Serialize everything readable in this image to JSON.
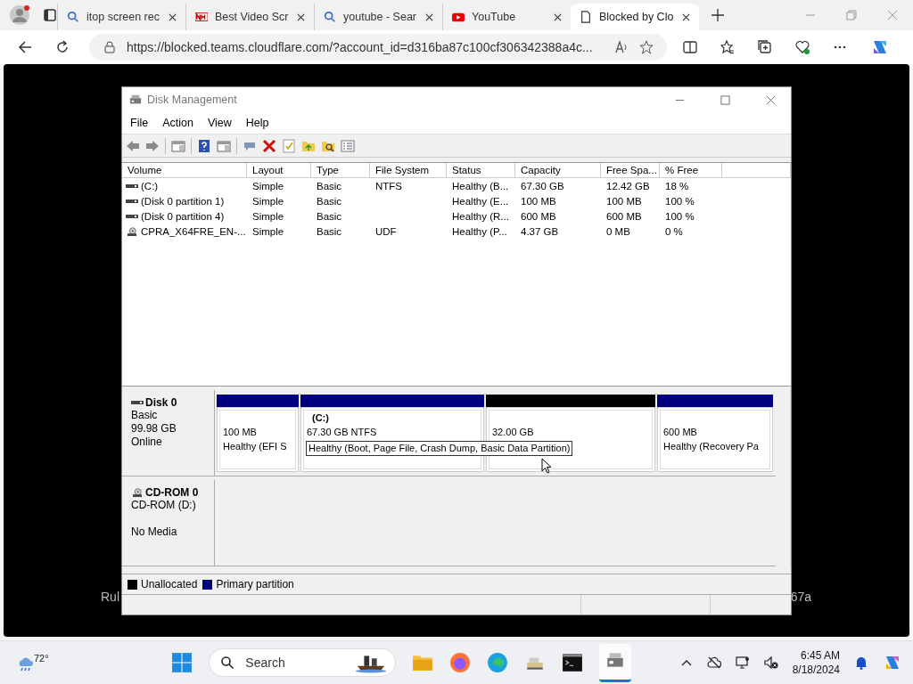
{
  "browser": {
    "tabs": [
      {
        "title": "itop screen rec",
        "kind": "search",
        "selected": false
      },
      {
        "title": "Best Video Scr",
        "kind": "nch",
        "selected": false
      },
      {
        "title": "youtube - Sear",
        "kind": "search",
        "selected": false
      },
      {
        "title": "YouTube",
        "kind": "youtube",
        "selected": false
      },
      {
        "title": "Blocked by Clo",
        "kind": "page",
        "selected": true
      }
    ],
    "url": "https://blocked.teams.cloudflare.com/?account_id=d316ba87c100cf306342388a4c...",
    "behind_left": "Rul",
    "behind_right": "67a"
  },
  "window": {
    "title": "Disk Management",
    "menu": [
      "File",
      "Action",
      "View",
      "Help"
    ],
    "columns": [
      "Volume",
      "Layout",
      "Type",
      "File System",
      "Status",
      "Capacity",
      "Free Spa...",
      "% Free"
    ],
    "rows": [
      {
        "kind": "disk",
        "cells": [
          "(C:)",
          "Simple",
          "Basic",
          "NTFS",
          "Healthy (B...",
          "67.30 GB",
          "12.42 GB",
          "18 %"
        ]
      },
      {
        "kind": "disk",
        "cells": [
          "(Disk 0 partition 1)",
          "Simple",
          "Basic",
          null,
          "Healthy (E...",
          "100 MB",
          "100 MB",
          "100 %"
        ]
      },
      {
        "kind": "disk",
        "cells": [
          "(Disk 0 partition 4)",
          "Simple",
          "Basic",
          null,
          "Healthy (R...",
          "600 MB",
          "600 MB",
          "100 %"
        ]
      },
      {
        "kind": "cd",
        "cells": [
          "CPRA_X64FRE_EN-...",
          "Simple",
          "Basic",
          "UDF",
          "Healthy (P...",
          "4.37 GB",
          "0 MB",
          "0 %"
        ]
      }
    ],
    "disks": [
      {
        "kind": "disk",
        "name": "Disk 0",
        "lines": [
          "Basic",
          "99.98 GB",
          "Online"
        ],
        "partitions": [
          {
            "kind": "primary",
            "lines": [
              "100 MB",
              "Healthy (EFI S"
            ],
            "focused": false
          },
          {
            "kind": "primary",
            "label": "(C:)",
            "lines": [
              "67.30 GB NTFS",
              "Healthy (Boot, Page File, Crash Dump, Basic Data Partition)"
            ],
            "focused": true
          },
          {
            "kind": "unallocated",
            "lines": [
              "32.00 GB"
            ],
            "focused": false
          },
          {
            "kind": "primary",
            "lines": [
              "600 MB",
              "Healthy (Recovery Pa"
            ],
            "focused": false
          }
        ]
      },
      {
        "kind": "cd",
        "name": "CD-ROM 0",
        "lines": [
          "CD-ROM (D:)",
          "No Media"
        ]
      }
    ],
    "legend": [
      {
        "label": "Unallocated",
        "color": "#000000"
      },
      {
        "label": "Primary partition",
        "color": "#000080"
      }
    ]
  },
  "taskbar": {
    "weather": "72°",
    "search": {
      "placeholder": "Search"
    },
    "time": "6:45 AM",
    "date": "8/18/2024"
  }
}
